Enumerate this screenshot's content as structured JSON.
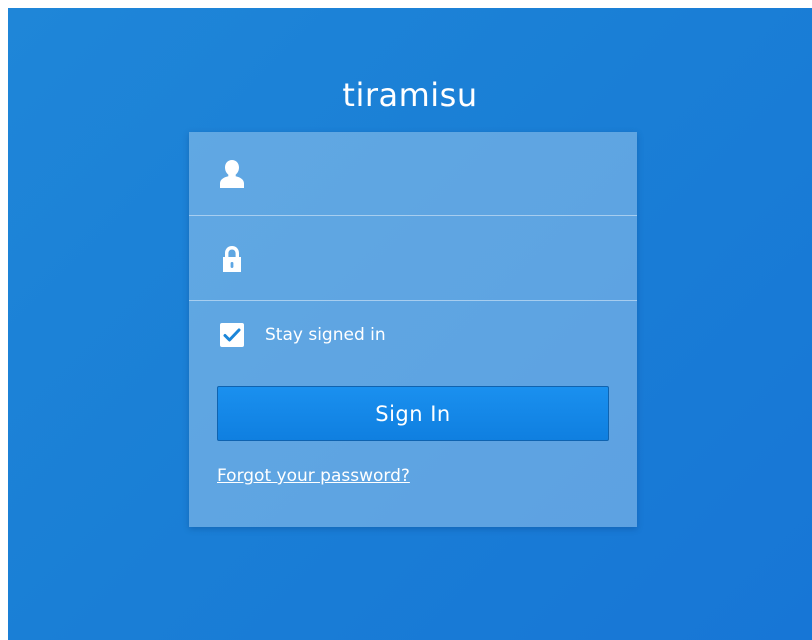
{
  "app": {
    "title": "tiramisu"
  },
  "login": {
    "username_placeholder": "",
    "password_placeholder": "",
    "stay_signed_in_label": "Stay signed in",
    "stay_signed_in_checked": true,
    "sign_in_label": "Sign In",
    "forgot_password_label": "Forgot your password?"
  },
  "icons": {
    "username": "user-icon",
    "password": "lock-icon",
    "checkbox": "checkmark-icon"
  },
  "colors": {
    "background": "#1a7fd6",
    "button": "#1588ea",
    "checkmark": "#1b86d9",
    "text": "#ffffff"
  }
}
